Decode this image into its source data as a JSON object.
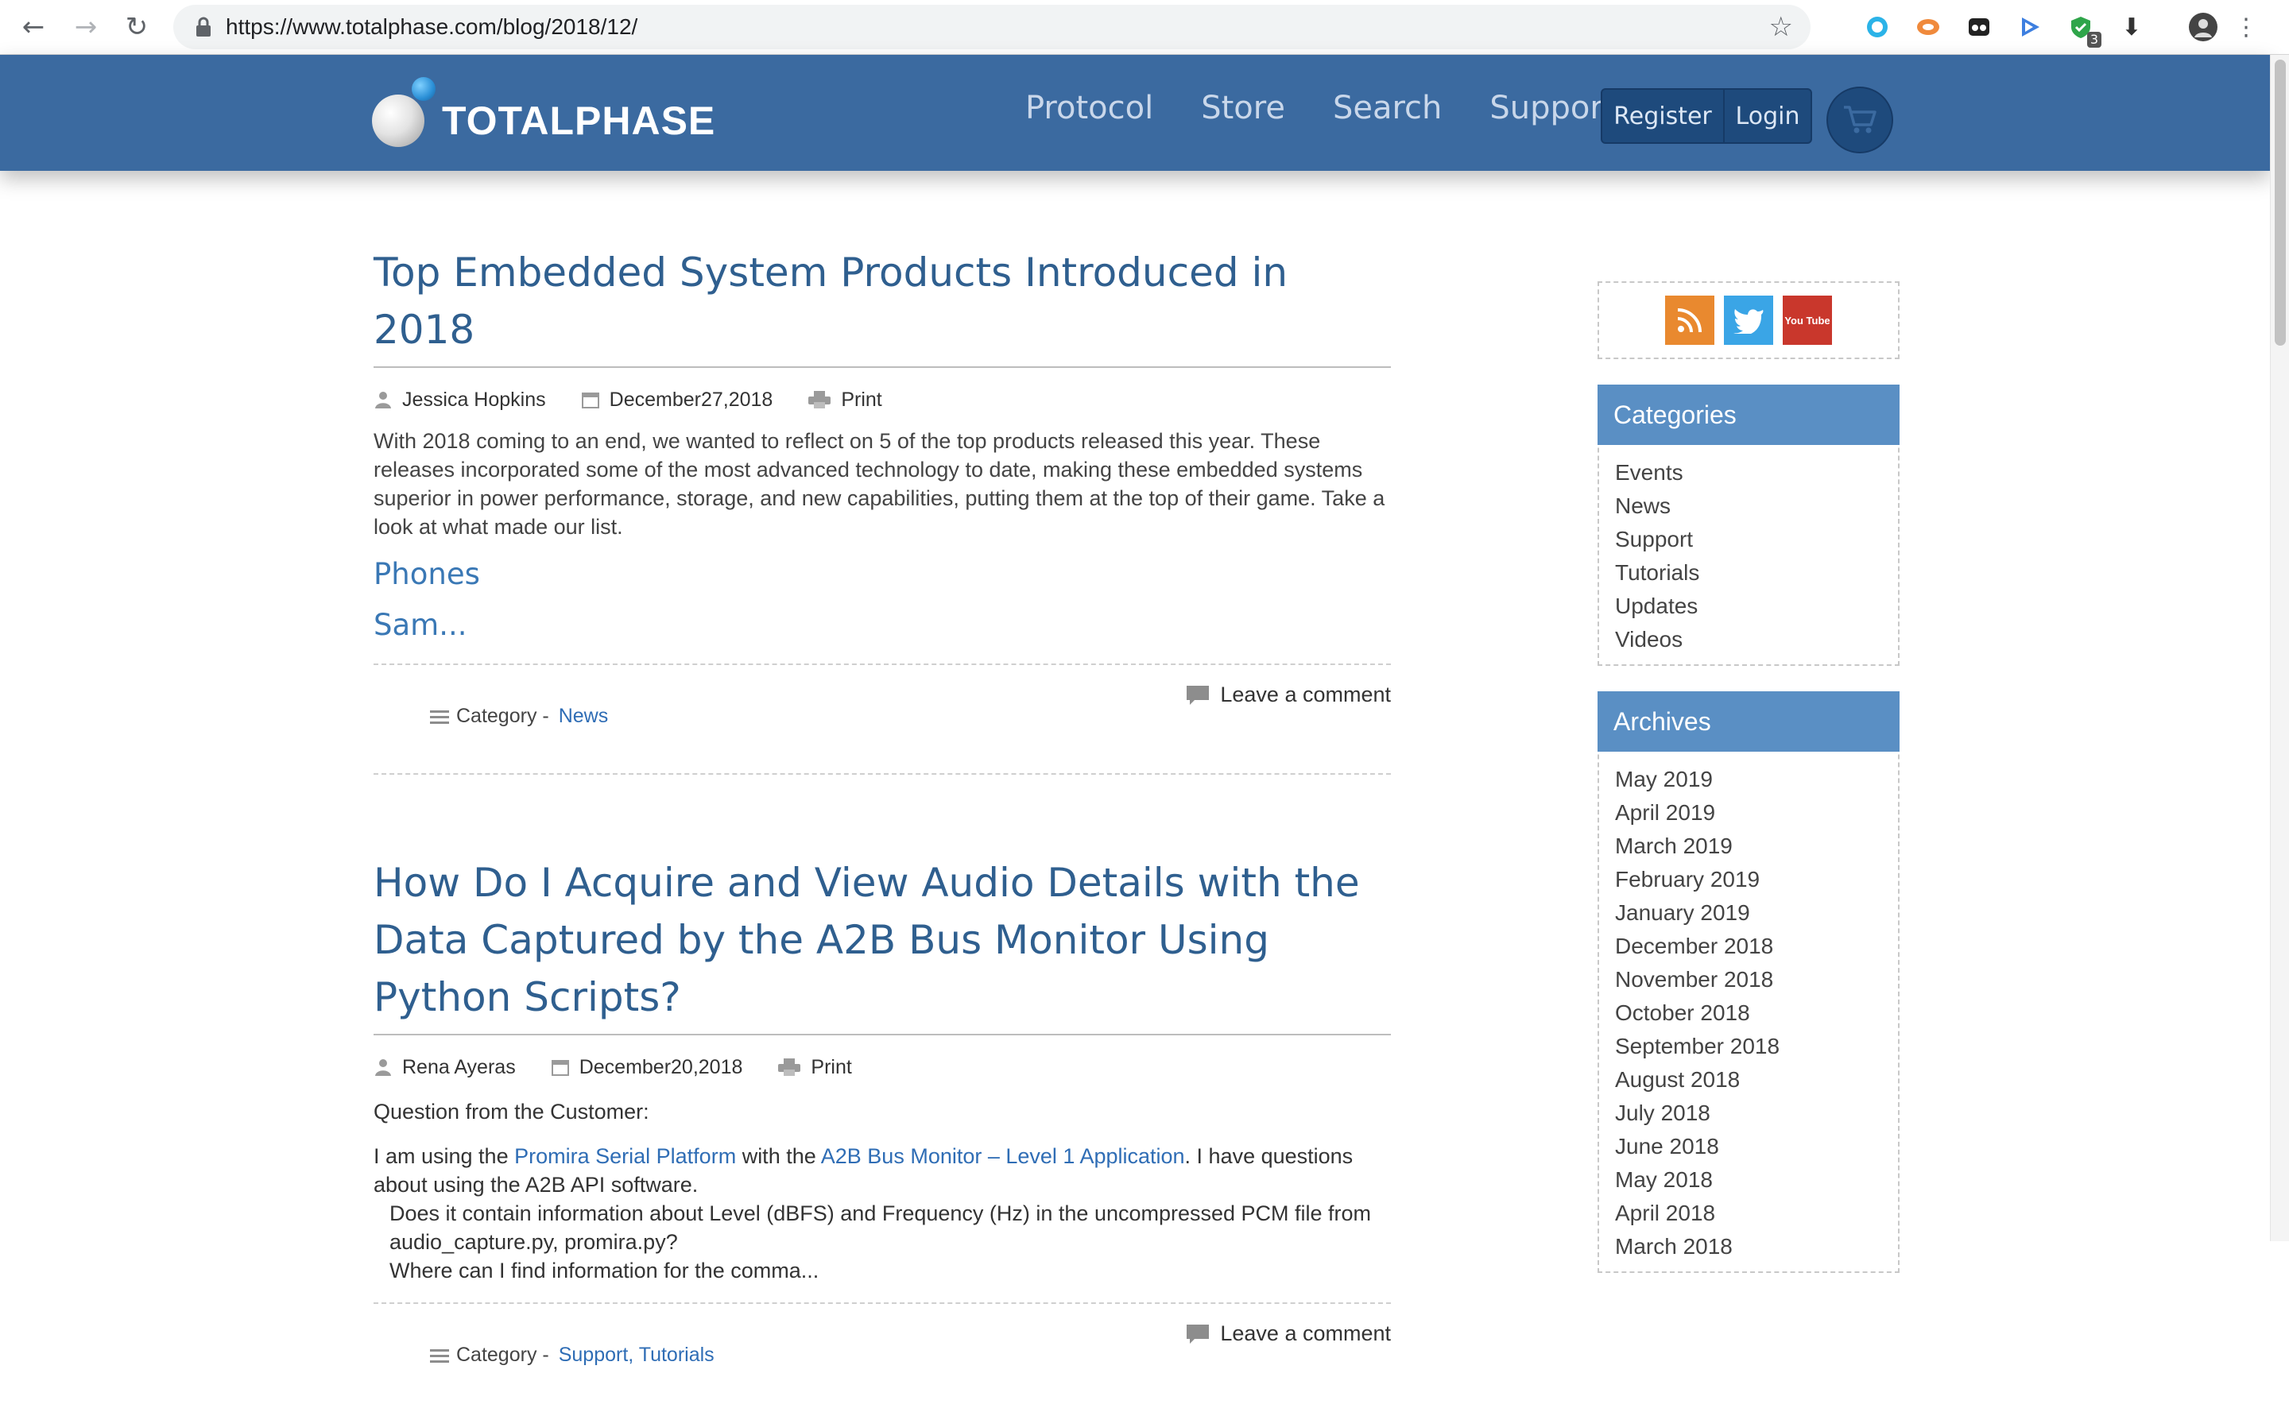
{
  "browser": {
    "url": "https://www.totalphase.com/blog/2018/12/",
    "extension_badge": "3"
  },
  "site": {
    "logo_text": "TOTALPHASE",
    "nav": [
      "Protocol",
      "Store",
      "Search",
      "Support"
    ],
    "register_label": "Register",
    "login_label": "Login"
  },
  "posts": [
    {
      "title": "Top Embedded System Products Introduced in 2018",
      "author": "Jessica Hopkins",
      "date": "December27,2018",
      "print_label": "Print",
      "excerpt": "With 2018 coming to an end, we wanted to reflect on 5 of the top products released this year. These releases incorporated some of the most advanced technology to date, making these embedded systems superior in power performance, storage, and new capabilities, putting them at the top of their game. Take a look at what made our list.",
      "subheading": "Phones",
      "teaser": "Sam...",
      "comment_label": "Leave a comment",
      "category_label": "Category -",
      "categories": "News"
    },
    {
      "title": "How Do I Acquire and View Audio Details with the Data Captured by the A2B Bus Monitor Using Python Scripts?",
      "author": "Rena Ayeras",
      "date": "December20,2018",
      "print_label": "Print",
      "question_heading": "Question from the Customer:",
      "body_prefix": "I am using the ",
      "link1": "Promira Serial Platform",
      "body_middle": " with the ",
      "link2": "A2B Bus Monitor – Level 1 Application",
      "body_suffix": ". I have questions about using the A2B API software.",
      "bullet1": "Does it contain information about Level (dBFS) and Frequency (Hz) in the uncompressed PCM file from audio_capture.py, promira.py?",
      "bullet2": "Where can I find information for the comma...",
      "comment_label": "Leave a comment",
      "category_label": "Category -",
      "categories": "Support, Tutorials"
    }
  ],
  "sidebar": {
    "social": {
      "youtube_label": "You Tube"
    },
    "categories_title": "Categories",
    "categories": [
      "Events",
      "News",
      "Support",
      "Tutorials",
      "Updates",
      "Videos"
    ],
    "archives_title": "Archives",
    "archives": [
      "May 2019",
      "April 2019",
      "March 2019",
      "February 2019",
      "January 2019",
      "December 2018",
      "November 2018",
      "October 2018",
      "September 2018",
      "August 2018",
      "July 2018",
      "June 2018",
      "May 2018",
      "April 2018",
      "March 2018"
    ]
  }
}
